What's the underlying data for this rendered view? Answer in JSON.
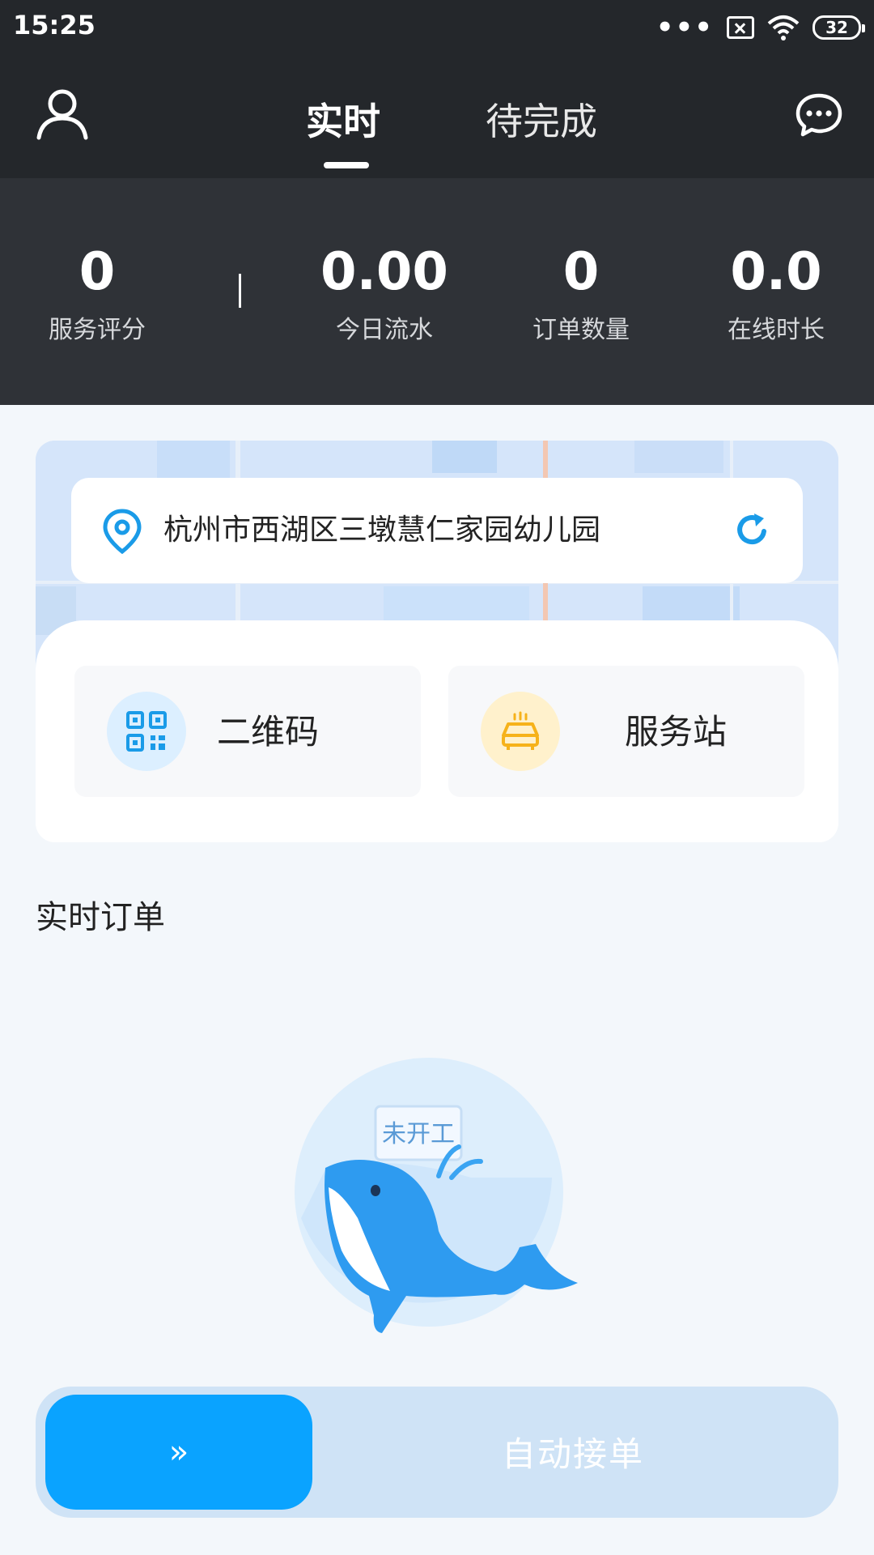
{
  "status_bar": {
    "time": "15:25",
    "dots": "•••",
    "battery": "32"
  },
  "nav": {
    "tabs": [
      {
        "label": "实时",
        "active": true
      },
      {
        "label": "待完成",
        "active": false
      }
    ],
    "left_icon": "user-icon",
    "right_icon": "message-icon"
  },
  "stats": [
    {
      "value": "0",
      "label": "服务评分"
    },
    {
      "value": "0.00",
      "label": "今日流水"
    },
    {
      "value": "0",
      "label": "订单数量"
    },
    {
      "value": "0.0",
      "label": "在线时长"
    }
  ],
  "location": {
    "address": "杭州市西湖区三墩慧仁家园幼儿园",
    "icons": [
      "location-pin-icon",
      "refresh-icon"
    ]
  },
  "actions": [
    {
      "label": "二维码",
      "icon": "qr-code-icon"
    },
    {
      "label": "服务站",
      "icon": "station-icon"
    }
  ],
  "orders": {
    "section_title": "实时订单",
    "empty_badge": "未开工"
  },
  "slider": {
    "handle": "»",
    "text": "自动接单"
  },
  "colors": {
    "header_dark": "#24272b",
    "stats_dark": "#2f3237",
    "accent_blue": "#0aa3ff",
    "icon_yellow": "#f6b21a"
  }
}
